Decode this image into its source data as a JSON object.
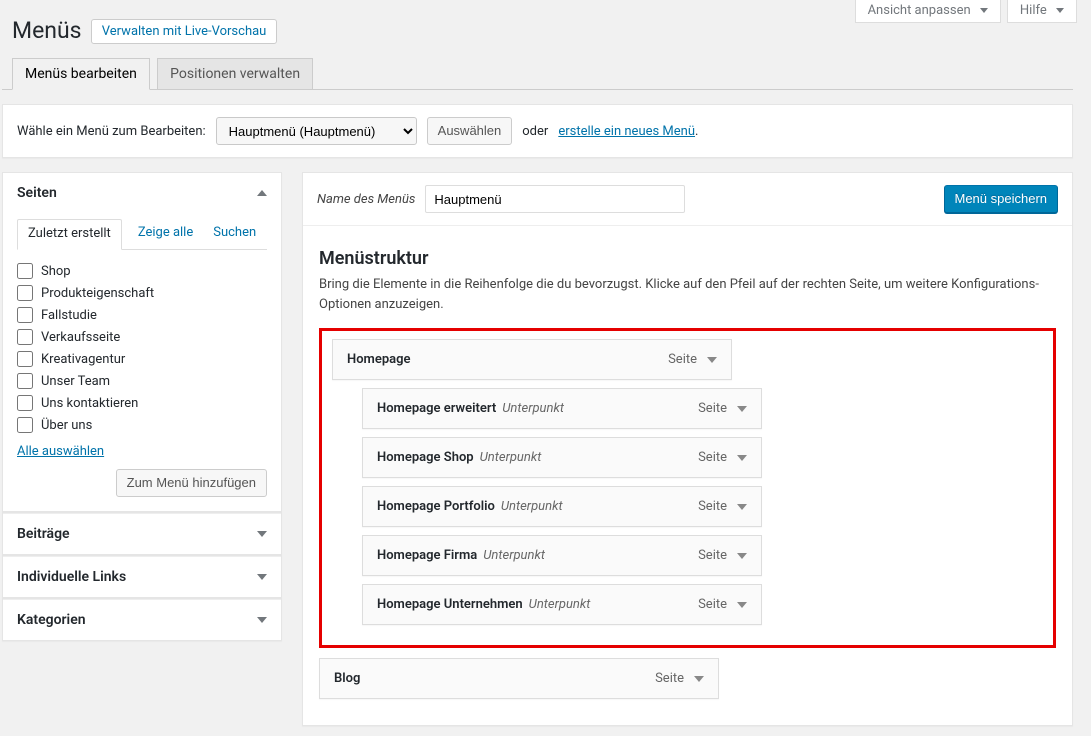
{
  "screen_options": {
    "customize_view": "Ansicht anpassen",
    "help": "Hilfe"
  },
  "page": {
    "title": "Menüs",
    "live_preview": "Verwalten mit Live-Vorschau",
    "tabs": {
      "edit": "Menüs bearbeiten",
      "locations": "Positionen verwalten"
    }
  },
  "selector": {
    "label": "Wähle ein Menü zum Bearbeiten:",
    "dropdown_value": "Hauptmenü (Hauptmenü)",
    "select_btn": "Auswählen",
    "or": "oder",
    "create_link": "erstelle ein neues Menü"
  },
  "sidebar": {
    "pages": {
      "title": "Seiten",
      "tabs": {
        "recent": "Zuletzt erstellt",
        "all": "Zeige alle",
        "search": "Suchen"
      },
      "items": [
        "Shop",
        "Produkteigenschaft",
        "Fallstudie",
        "Verkaufsseite",
        "Kreativagentur",
        "Unser Team",
        "Uns kontaktieren",
        "Über uns"
      ],
      "select_all": "Alle auswählen",
      "add_btn": "Zum Menü hinzufügen"
    },
    "posts": "Beiträge",
    "custom_links": "Individuelle Links",
    "categories": "Kategorien"
  },
  "menu": {
    "name_label": "Name des Menüs",
    "name_value": "Hauptmenü",
    "save_btn": "Menü speichern",
    "structure_heading": "Menüstruktur",
    "structure_help": "Bring die Elemente in die Reihenfolge die du bevorzugst. Klicke auf den Pfeil auf der rechten Seite, um weitere Konfigurations-Optionen anzuzeigen.",
    "type_page": "Seite",
    "subitem_label": "Unterpunkt",
    "items": [
      {
        "title": "Homepage",
        "sub": false
      },
      {
        "title": "Homepage erweitert",
        "sub": true
      },
      {
        "title": "Homepage Shop",
        "sub": true
      },
      {
        "title": "Homepage Portfolio",
        "sub": true
      },
      {
        "title": "Homepage Firma",
        "sub": true
      },
      {
        "title": "Homepage Unternehmen",
        "sub": true
      }
    ],
    "after_items": [
      {
        "title": "Blog",
        "sub": false
      }
    ]
  },
  "punctuation": {
    "period": "."
  }
}
